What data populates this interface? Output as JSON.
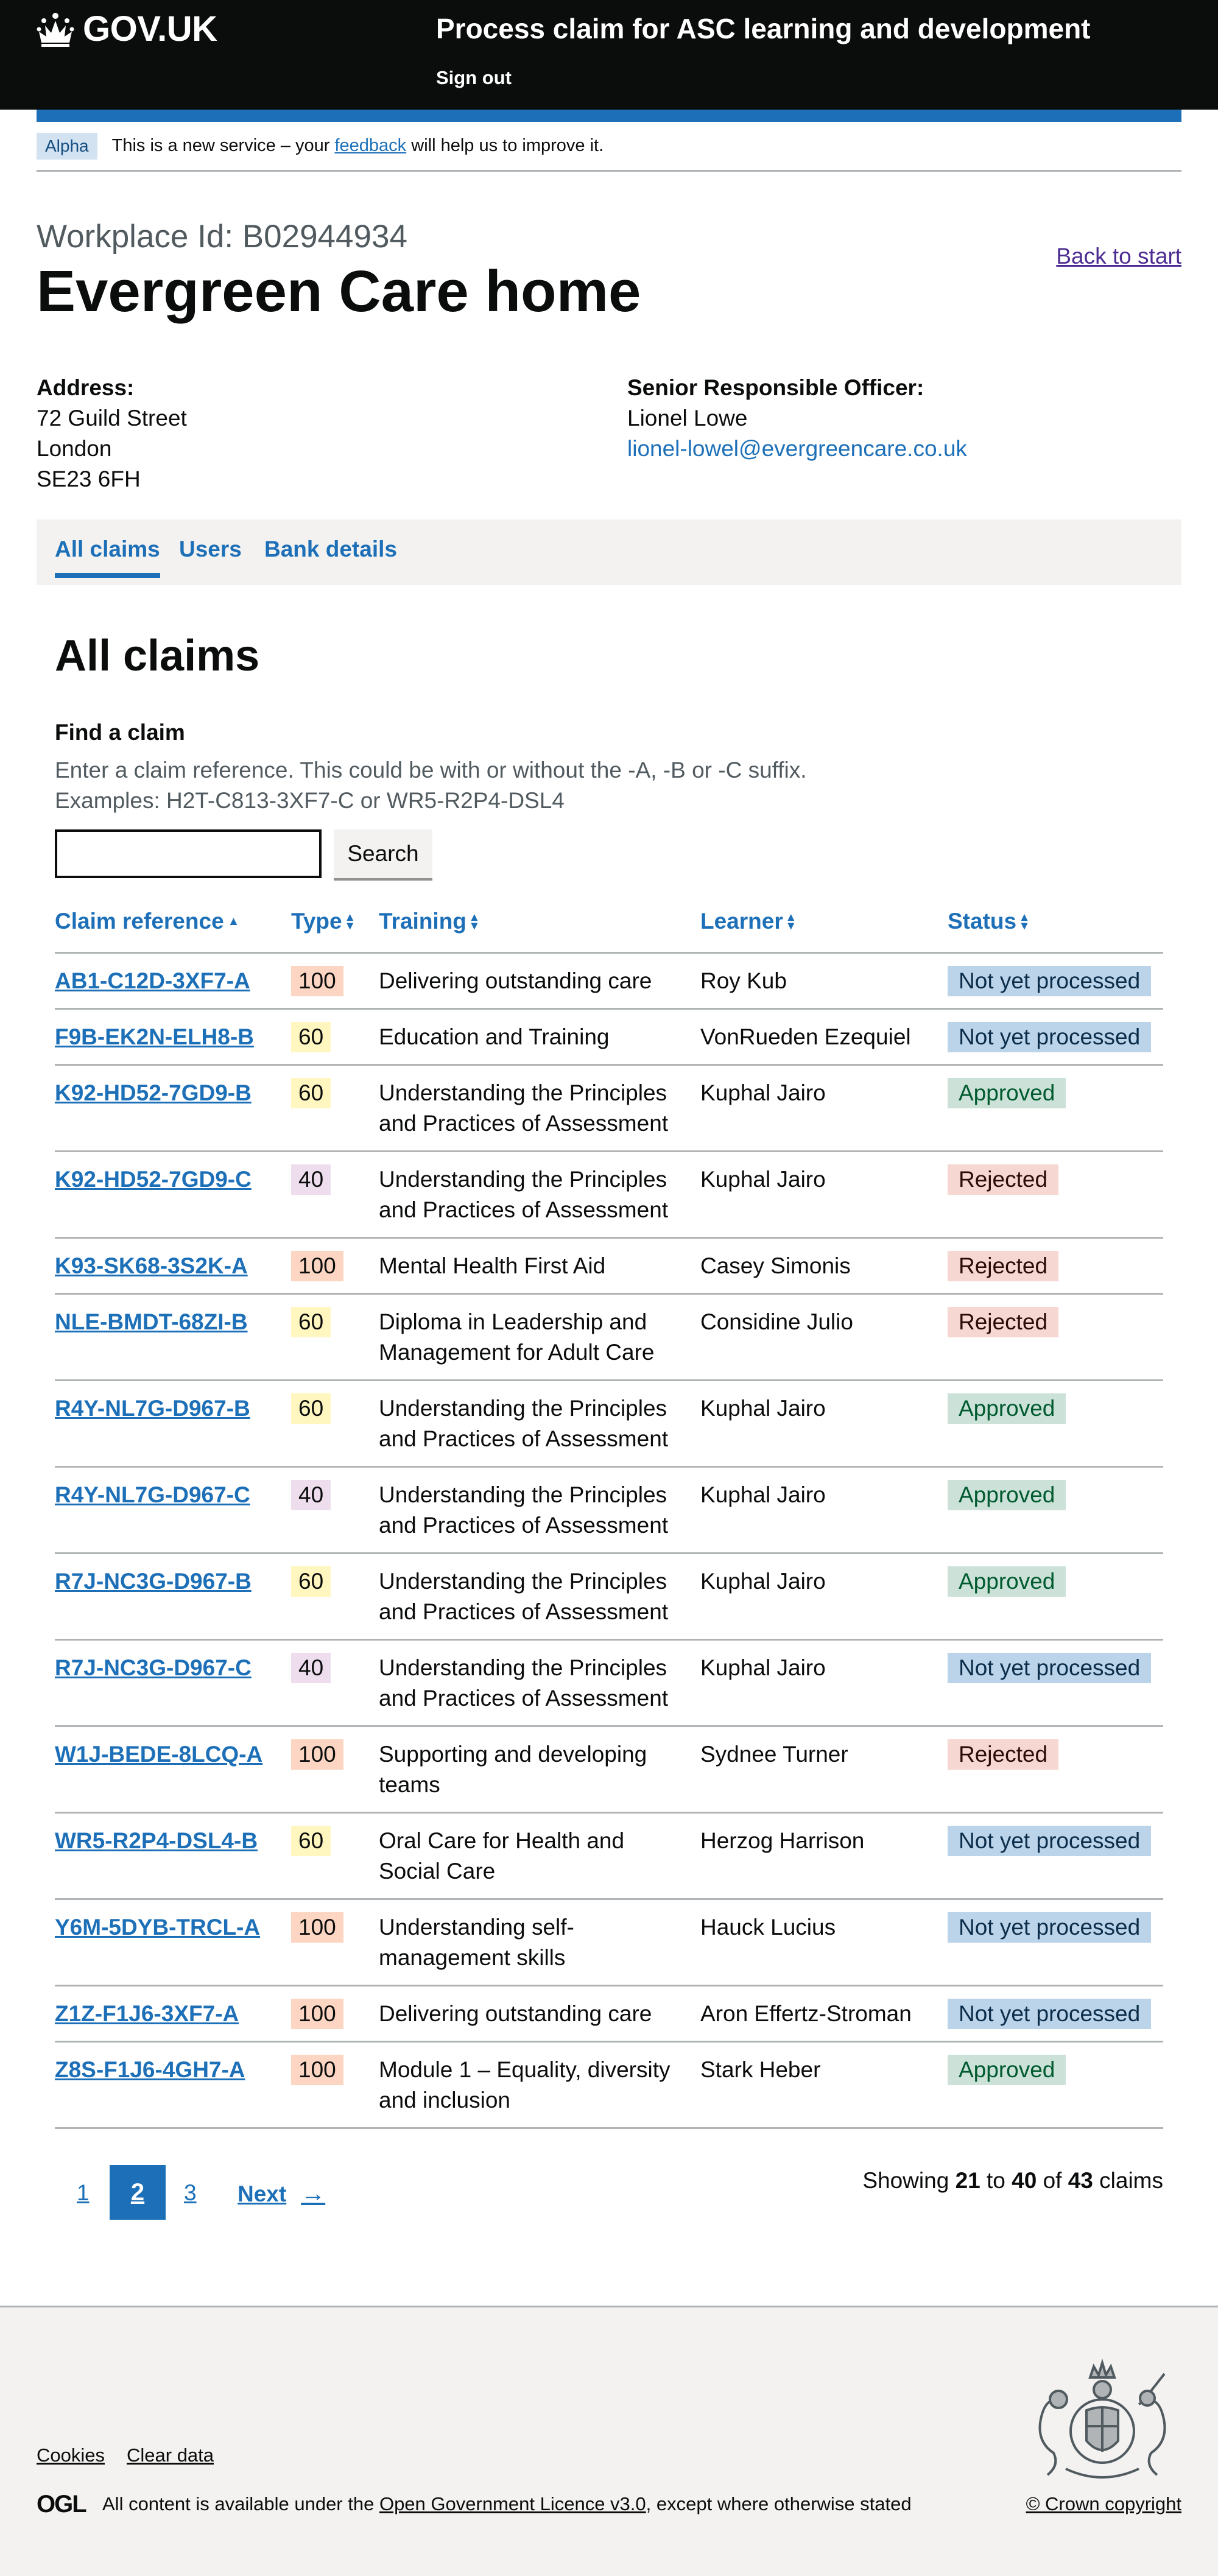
{
  "header": {
    "logo_text": "GOV.UK",
    "service_name": "Process claim for ASC learning and development",
    "sign_out": "Sign out"
  },
  "phase_banner": {
    "tag": "Alpha",
    "text_before": "This is a new service – your ",
    "link": "feedback",
    "text_after": " will help us to improve it."
  },
  "workplace": {
    "caption": "Workplace Id: B02944934",
    "title": "Evergreen Care home",
    "back_link": "Back to start",
    "address_label": "Address:",
    "address_lines": [
      "72 Guild Street",
      "London",
      "SE23 6FH"
    ],
    "sro_label": "Senior Responsible Officer:",
    "sro_name": "Lionel Lowe",
    "sro_email": "lionel-lowel@evergreencare.co.uk"
  },
  "tabs": [
    "All claims",
    "Users",
    "Bank details"
  ],
  "section_title": "All claims",
  "search": {
    "label": "Find a claim",
    "hint_line1": "Enter a claim reference. This could be with or without the -A, -B or -C suffix.",
    "hint_line2": "Examples: H2T-C813-3XF7-C or WR5-R2P4-DSL4",
    "value": "",
    "button": "Search"
  },
  "table": {
    "headers": [
      "Claim reference",
      "Type",
      "Training",
      "Learner",
      "Status"
    ],
    "rows": [
      {
        "ref": "AB1-C12D-3XF7-A",
        "type": "100",
        "training": "Delivering outstanding care",
        "learner": "Roy Kub",
        "status": "Not yet processed"
      },
      {
        "ref": "F9B-EK2N-ELH8-B",
        "type": "60",
        "training": "Education and Training",
        "learner": "VonRueden Ezequiel",
        "status": "Not yet processed"
      },
      {
        "ref": "K92-HD52-7GD9-B",
        "type": "60",
        "training": "Understanding the Principles and Practices of Assessment",
        "learner": "Kuphal Jairo",
        "status": "Approved"
      },
      {
        "ref": "K92-HD52-7GD9-C",
        "type": "40",
        "training": "Understanding the Principles and Practices of Assessment",
        "learner": "Kuphal Jairo",
        "status": "Rejected"
      },
      {
        "ref": "K93-SK68-3S2K-A",
        "type": "100",
        "training": "Mental Health First Aid",
        "learner": "Casey Simonis",
        "status": "Rejected"
      },
      {
        "ref": "NLE-BMDT-68ZI-B",
        "type": "60",
        "training": "Diploma in Leadership and Management for Adult Care",
        "learner": "Considine Julio",
        "status": "Rejected"
      },
      {
        "ref": "R4Y-NL7G-D967-B",
        "type": "60",
        "training": "Understanding the Principles and Practices of Assessment",
        "learner": "Kuphal Jairo",
        "status": "Approved"
      },
      {
        "ref": "R4Y-NL7G-D967-C",
        "type": "40",
        "training": "Understanding the Principles and Practices of Assessment",
        "learner": "Kuphal Jairo",
        "status": "Approved"
      },
      {
        "ref": "R7J-NC3G-D967-B",
        "type": "60",
        "training": "Understanding the Principles and Practices of Assessment",
        "learner": "Kuphal Jairo",
        "status": "Approved"
      },
      {
        "ref": "R7J-NC3G-D967-C",
        "type": "40",
        "training": "Understanding the Principles and Practices of Assessment",
        "learner": "Kuphal Jairo",
        "status": "Not yet processed"
      },
      {
        "ref": "W1J-BEDE-8LCQ-A",
        "type": "100",
        "training": "Supporting and developing teams",
        "learner": "Sydnee Turner",
        "status": "Rejected"
      },
      {
        "ref": "WR5-R2P4-DSL4-B",
        "type": "60",
        "training": "Oral Care for Health and Social Care",
        "learner": "Herzog Harrison",
        "status": "Not yet processed"
      },
      {
        "ref": "Y6M-5DYB-TRCL-A",
        "type": "100",
        "training": "Understanding self-management skills",
        "learner": "Hauck Lucius",
        "status": "Not yet processed"
      },
      {
        "ref": "Z1Z-F1J6-3XF7-A",
        "type": "100",
        "training": "Delivering outstanding care",
        "learner": "Aron Effertz-Stroman",
        "status": "Not yet processed"
      },
      {
        "ref": "Z8S-F1J6-4GH7-A",
        "type": "100",
        "training": "Module 1 – Equality, diversity and inclusion",
        "learner": "Stark Heber",
        "status": "Approved"
      }
    ]
  },
  "colors": {
    "type_100": "#fcd6c3",
    "type_60": "#fff7bf",
    "type_40": "#eddded",
    "status_not_yet_processed": {
      "bg": "#bbd4ea",
      "fg": "#0c2d4a"
    },
    "status_approved": {
      "bg": "#cce2d8",
      "fg": "#005a30"
    },
    "status_rejected": {
      "bg": "#f6d7d2",
      "fg": "#2a0b06"
    }
  },
  "pagination": {
    "pages": [
      "1",
      "2",
      "3"
    ],
    "current": "2",
    "next": "Next",
    "showing_prefix": "Showing",
    "from": "21",
    "to_word": "to",
    "to": "40",
    "of_word": "of",
    "total": "43",
    "suffix": "claims"
  },
  "footer": {
    "cookies": "Cookies",
    "clear_data": "Clear data",
    "ogl": "OGL",
    "licence_before": "All content is available under the ",
    "licence_link": "Open Government Licence v3.0",
    "licence_after": ", except where otherwise stated",
    "copyright": "© Crown copyright"
  }
}
